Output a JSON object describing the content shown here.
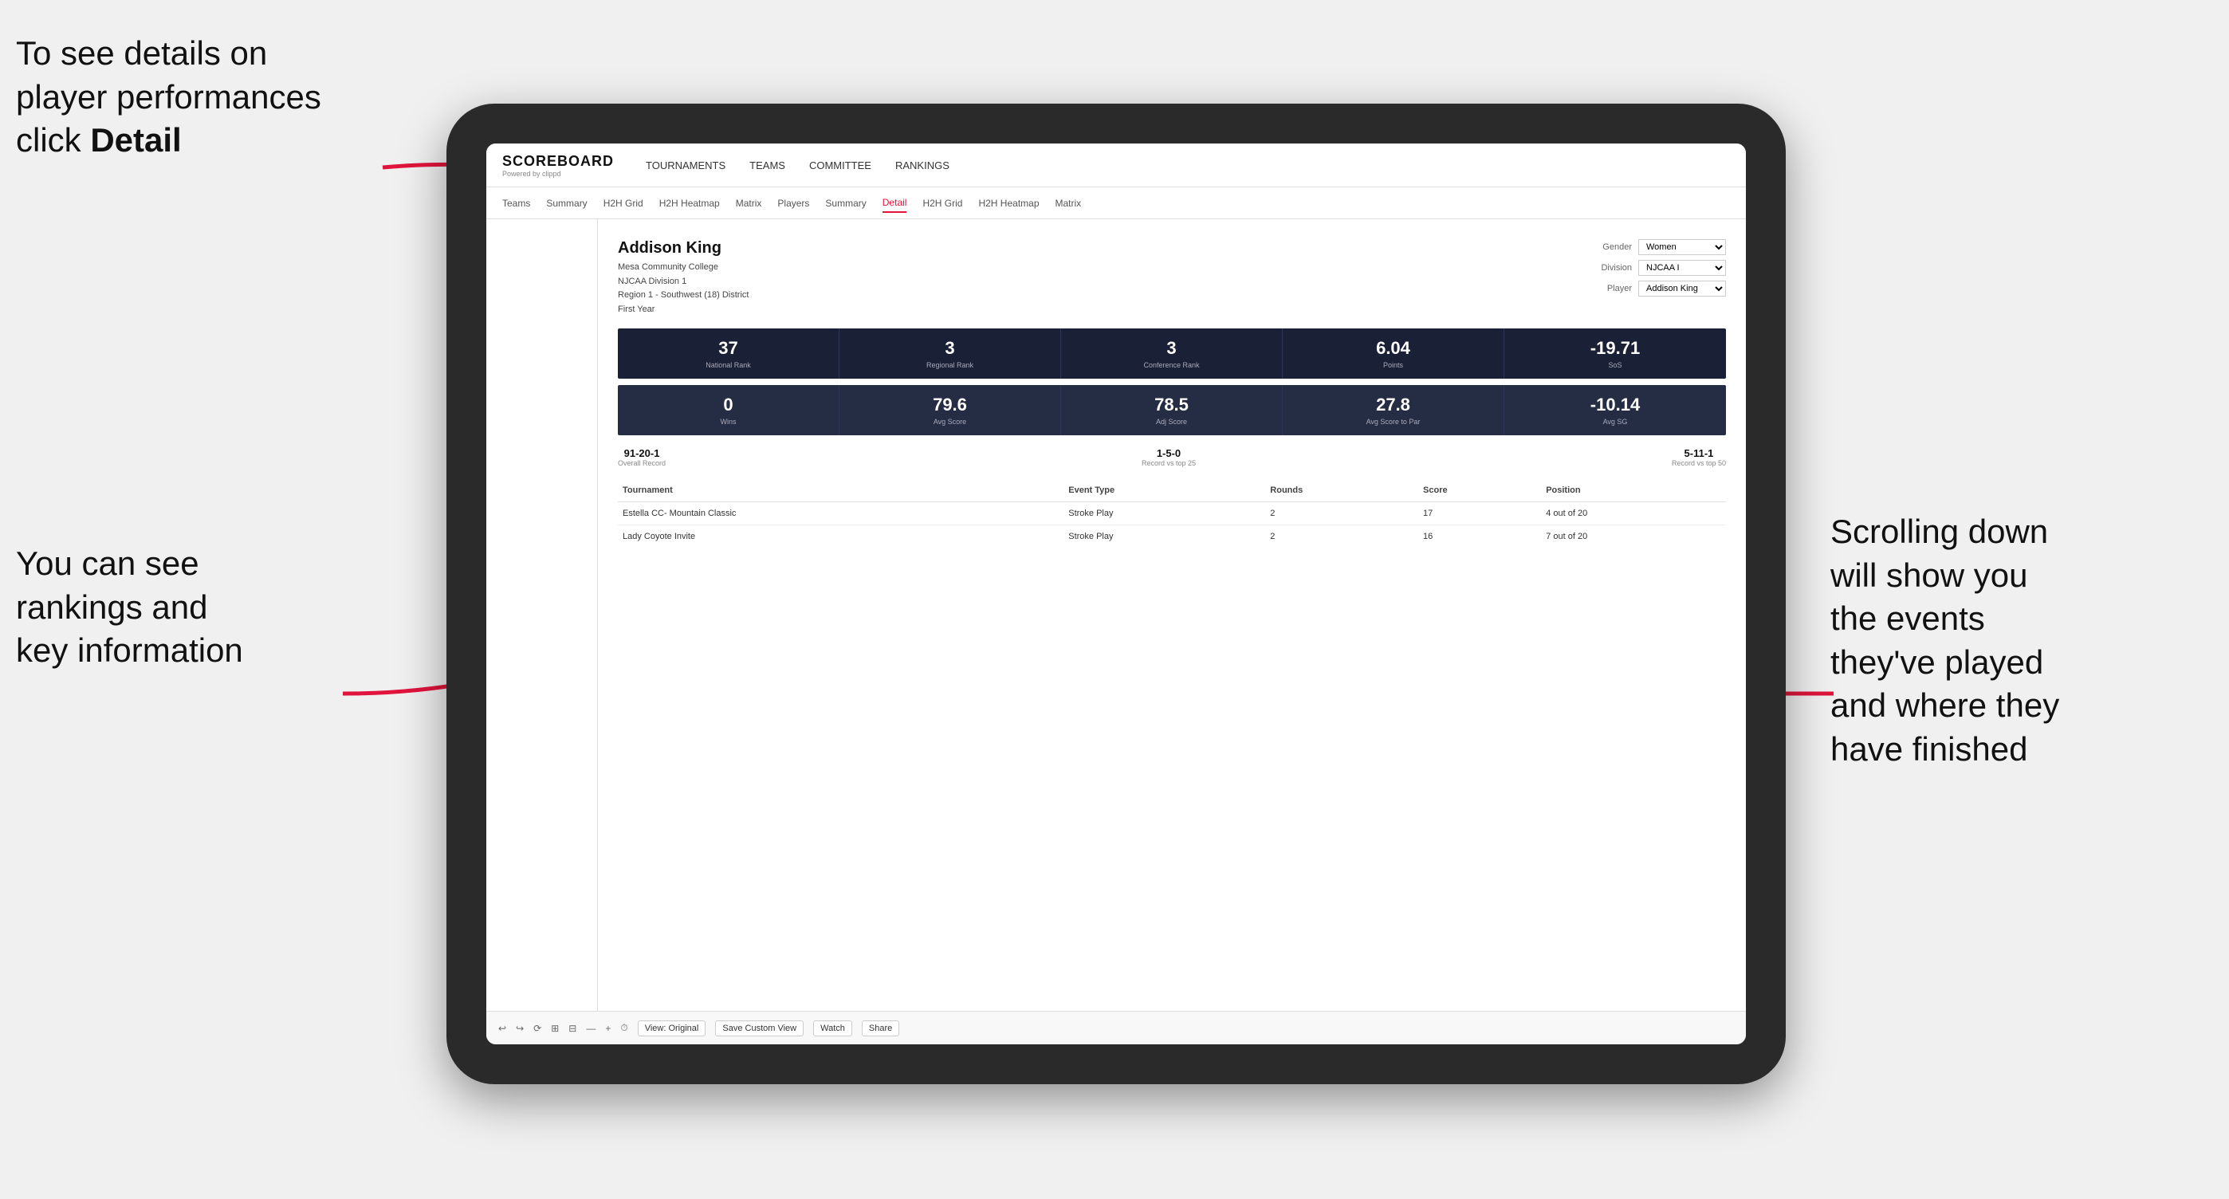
{
  "annotations": {
    "topleft": {
      "line1": "To see details on",
      "line2": "player performances",
      "line3_prefix": "click ",
      "line3_bold": "Detail"
    },
    "bottomleft": {
      "line1": "You can see",
      "line2": "rankings and",
      "line3": "key information"
    },
    "right": {
      "line1": "Scrolling down",
      "line2": "will show you",
      "line3": "the events",
      "line4": "they've played",
      "line5": "and where they",
      "line6": "have finished"
    }
  },
  "nav": {
    "logo": "SCOREBOARD",
    "logo_sub": "Powered by clippd",
    "items": [
      "TOURNAMENTS",
      "TEAMS",
      "COMMITTEE",
      "RANKINGS"
    ]
  },
  "subnav": {
    "items": [
      "Teams",
      "Summary",
      "H2H Grid",
      "H2H Heatmap",
      "Matrix",
      "Players",
      "Summary",
      "Detail",
      "H2H Grid",
      "H2H Heatmap",
      "Matrix"
    ],
    "active": "Detail"
  },
  "player": {
    "name": "Addison King",
    "school": "Mesa Community College",
    "division": "NJCAA Division 1",
    "region": "Region 1 - Southwest (18) District",
    "year": "First Year"
  },
  "filters": {
    "gender_label": "Gender",
    "gender_value": "Women",
    "division_label": "Division",
    "division_value": "NJCAA I",
    "player_label": "Player",
    "player_value": "Addison King"
  },
  "stats_row1": [
    {
      "value": "37",
      "label": "National Rank"
    },
    {
      "value": "3",
      "label": "Regional Rank"
    },
    {
      "value": "3",
      "label": "Conference Rank"
    },
    {
      "value": "6.04",
      "label": "Points"
    },
    {
      "value": "-19.71",
      "label": "SoS"
    }
  ],
  "stats_row2": [
    {
      "value": "0",
      "label": "Wins"
    },
    {
      "value": "79.6",
      "label": "Avg Score"
    },
    {
      "value": "78.5",
      "label": "Adj Score"
    },
    {
      "value": "27.8",
      "label": "Avg Score to Par"
    },
    {
      "value": "-10.14",
      "label": "Avg SG"
    }
  ],
  "records": [
    {
      "value": "91-20-1",
      "label": "Overall Record"
    },
    {
      "value": "1-5-0",
      "label": "Record vs top 25"
    },
    {
      "value": "5-11-1",
      "label": "Record vs top 50"
    }
  ],
  "table": {
    "headers": [
      "Tournament",
      "Event Type",
      "Rounds",
      "Score",
      "Position"
    ],
    "rows": [
      {
        "tournament": "Estella CC- Mountain Classic",
        "event_type": "Stroke Play",
        "rounds": "2",
        "score": "17",
        "position": "4 out of 20"
      },
      {
        "tournament": "Lady Coyote Invite",
        "event_type": "Stroke Play",
        "rounds": "2",
        "score": "16",
        "position": "7 out of 20"
      }
    ]
  },
  "toolbar": {
    "icons": [
      "↩",
      "↪",
      "⟳",
      "⊞",
      "⊟",
      "—",
      "+",
      "⏱"
    ],
    "btn_view": "View: Original",
    "btn_save": "Save Custom View",
    "btn_watch": "Watch",
    "btn_share": "Share"
  }
}
